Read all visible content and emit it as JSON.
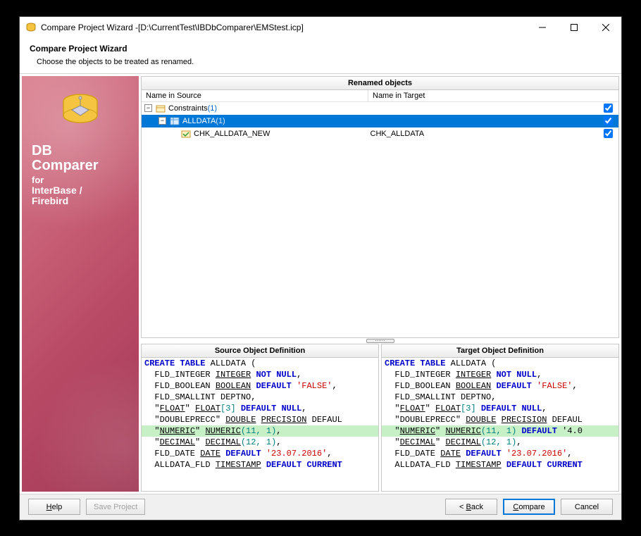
{
  "titlebar": {
    "text": "Compare Project Wizard -[D:\\CurrentTest\\IBDbComparer\\EMStest.icp]"
  },
  "header": {
    "title": "Compare Project Wizard",
    "subtitle": "Choose the objects to be treated as renamed."
  },
  "sidebar": {
    "line1": "DB",
    "line2": "Comparer",
    "line3": "for",
    "line4": "InterBase /",
    "line5": "Firebird"
  },
  "grid": {
    "group_header": "Renamed objects",
    "col_source": "Name in Source",
    "col_target": "Name in Target",
    "row0_label": "Constraints",
    "row0_count": " (1)",
    "row1_label": "ALLDATA",
    "row1_count": " (1)",
    "row2_source": "CHK_ALLDATA_NEW",
    "row2_target": "CHK_ALLDATA"
  },
  "defs": {
    "source_header": "Source Object Definition",
    "target_header": "Target Object Definition"
  },
  "chart_data": {
    "type": "table",
    "name": "object_definitions",
    "source_code": [
      {
        "t": "CREATE TABLE ALLDATA ("
      },
      {
        "t": "  FLD_INTEGER INTEGER NOT NULL,"
      },
      {
        "t": "  FLD_BOOLEAN BOOLEAN DEFAULT 'FALSE',"
      },
      {
        "t": "  FLD_SMALLINT DEPTNO,"
      },
      {
        "t": "  \"FLOAT\" FLOAT[3] DEFAULT NULL,"
      },
      {
        "t": "  \"DOUBLEPRECC\" DOUBLE PRECISION DEFAUL"
      },
      {
        "t": "  \"NUMERIC\" NUMERIC(11, 1),",
        "hl": true
      },
      {
        "t": "  \"DECIMAL\" DECIMAL(12, 1),"
      },
      {
        "t": "  FLD_DATE DATE DEFAULT '23.07.2016',"
      },
      {
        "t": "  ALLDATA_FLD TIMESTAMP DEFAULT CURRENT"
      }
    ],
    "target_code": [
      {
        "t": "CREATE TABLE ALLDATA ("
      },
      {
        "t": "  FLD_INTEGER INTEGER NOT NULL,"
      },
      {
        "t": "  FLD_BOOLEAN BOOLEAN DEFAULT 'FALSE',"
      },
      {
        "t": "  FLD_SMALLINT DEPTNO,"
      },
      {
        "t": "  \"FLOAT\" FLOAT[3] DEFAULT NULL,"
      },
      {
        "t": "  \"DOUBLEPRECC\" DOUBLE PRECISION DEFAUL"
      },
      {
        "t": "  \"NUMERIC\" NUMERIC(11, 1) DEFAULT '4.0",
        "hl": true
      },
      {
        "t": "  \"DECIMAL\" DECIMAL(12, 1),"
      },
      {
        "t": "  FLD_DATE DATE DEFAULT '23.07.2016',"
      },
      {
        "t": "  ALLDATA_FLD TIMESTAMP DEFAULT CURRENT"
      }
    ]
  },
  "footer": {
    "help": "Help",
    "save": "Save Project",
    "back": "< Back",
    "compare": "Compare",
    "cancel": "Cancel"
  }
}
